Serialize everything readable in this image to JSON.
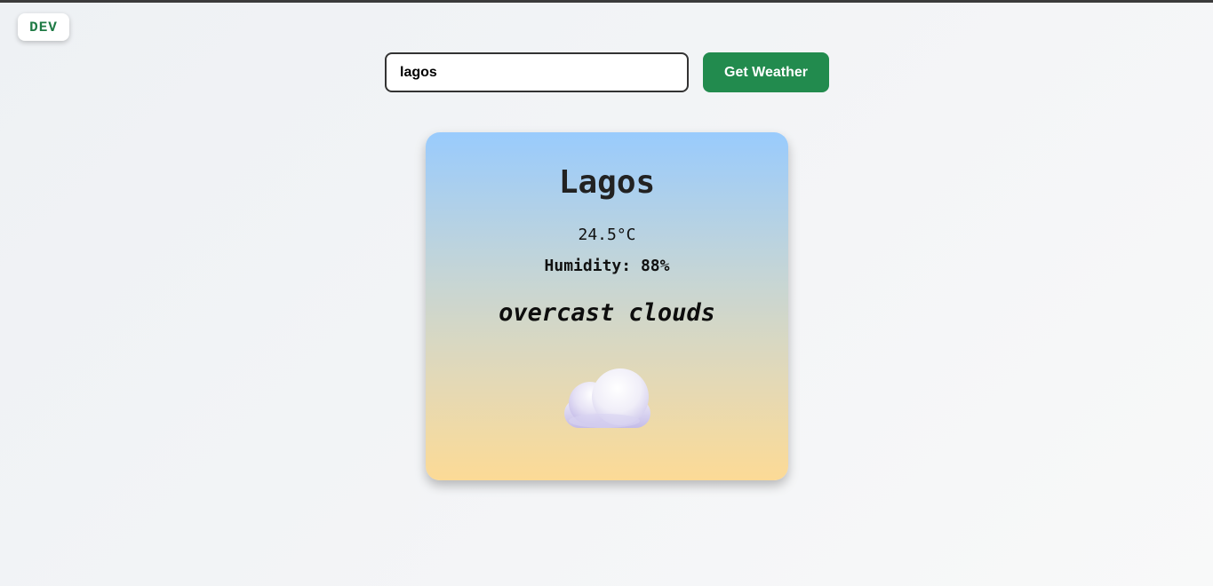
{
  "badge": {
    "label": "DEV"
  },
  "search": {
    "value": "lagos"
  },
  "button": {
    "label": "Get Weather"
  },
  "weather": {
    "city": "Lagos",
    "temperature": "24.5°C",
    "humidity_label": "Humidity:",
    "humidity_value": "88%",
    "description": "overcast clouds",
    "icon": "cloud-icon"
  },
  "colors": {
    "button": "#228b4e",
    "badge_text": "#1e7a44",
    "card_top": "#99cbfd",
    "card_bottom": "#fcda96"
  }
}
